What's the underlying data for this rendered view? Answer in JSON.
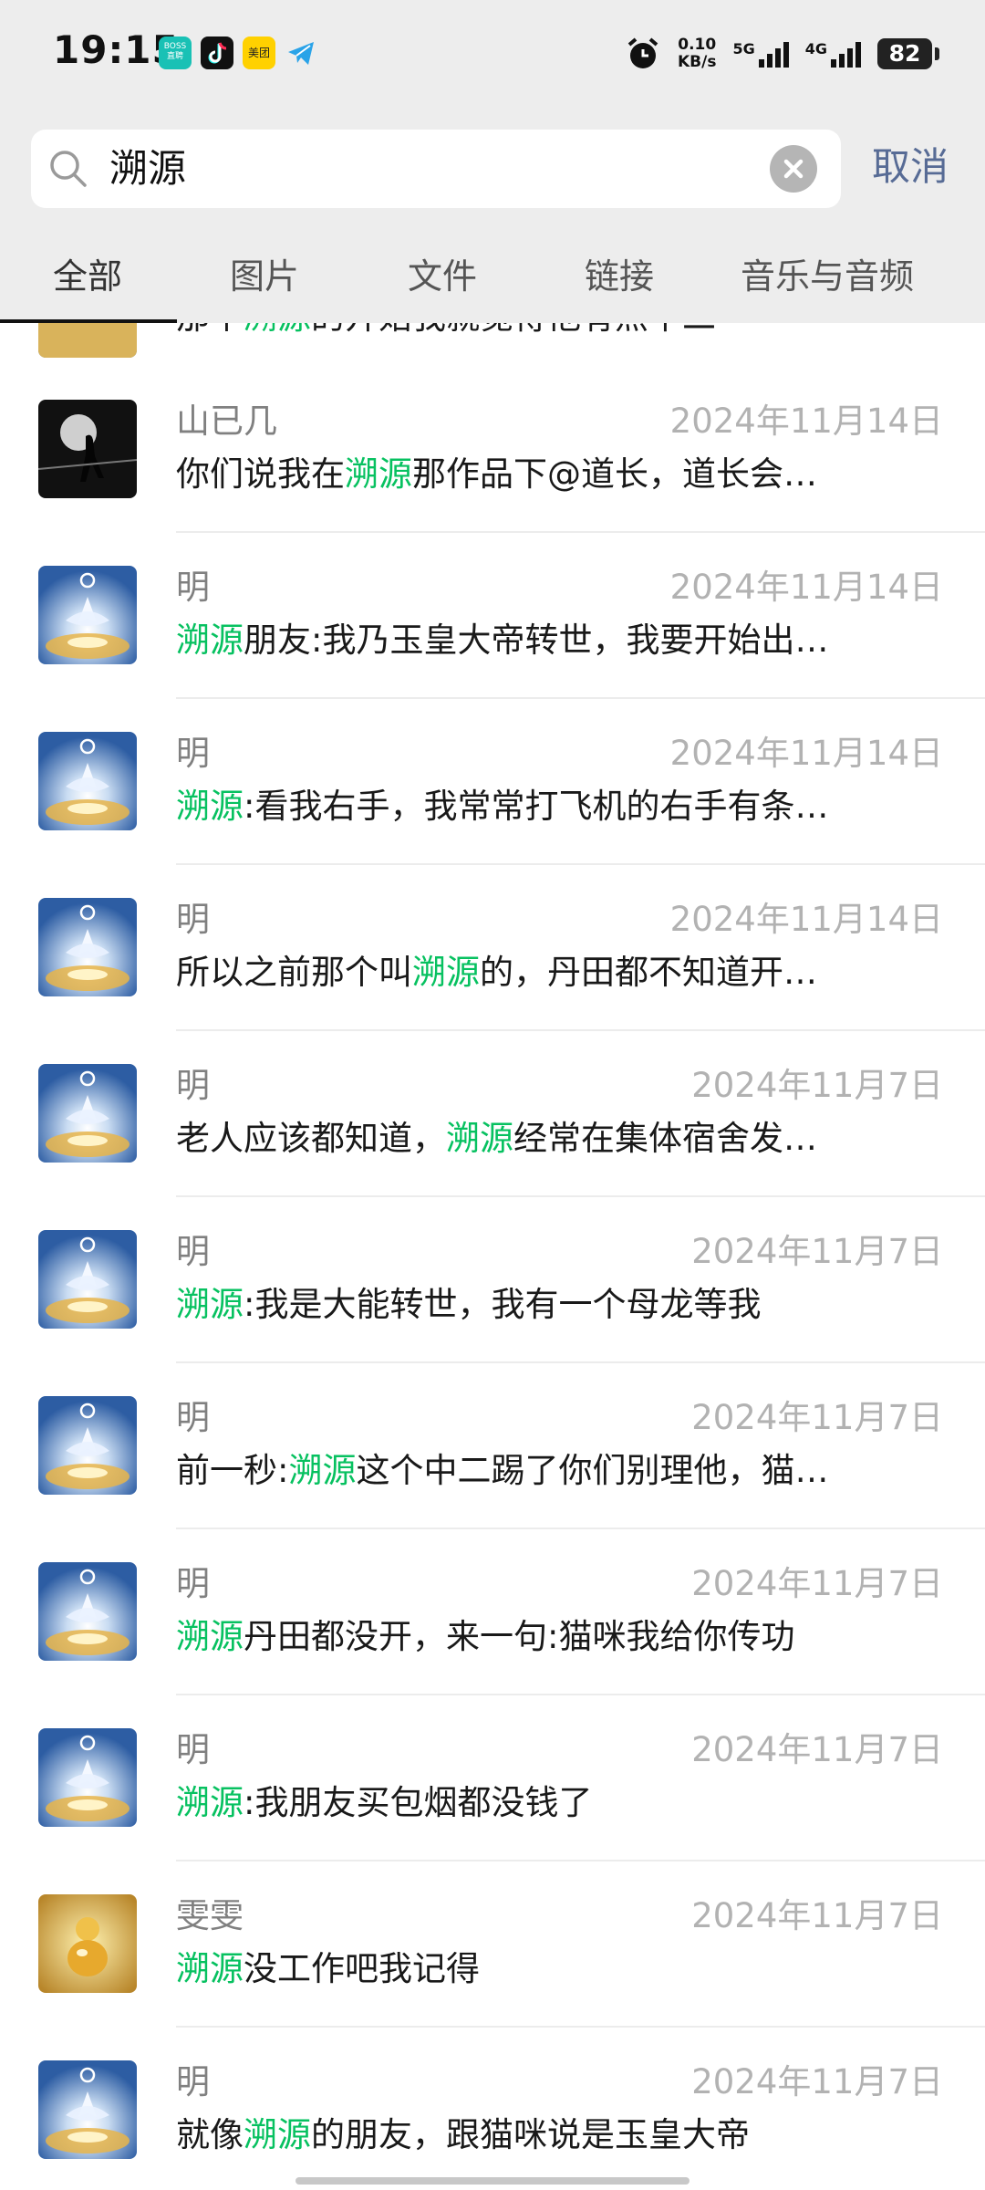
{
  "status_bar": {
    "time": "19:15",
    "net_speed_value": "0.10",
    "net_speed_unit": "KB/s",
    "signal_1_label": "5G",
    "signal_2_label": "4G",
    "battery": "82",
    "app_icons": [
      {
        "name": "boss-zhipin-icon",
        "text": "BOSS 直聘",
        "color": "#19c1b5"
      },
      {
        "name": "tiktok-icon",
        "text": "",
        "color": "#111111"
      },
      {
        "name": "meituan-icon",
        "text": "美团",
        "color": "#ffd100"
      },
      {
        "name": "telegram-icon",
        "text": "",
        "color": "#2aa3e8"
      }
    ],
    "alarm_icon": "alarm-clock-icon"
  },
  "search": {
    "query": "溯源",
    "cancel_label": "取消"
  },
  "tabs": [
    "全部",
    "图片",
    "文件",
    "链接",
    "音乐与音频"
  ],
  "active_tab": 0,
  "highlight_color": "#07c160",
  "partial_first_row": {
    "msg_before": "那个",
    "msg_hl": "溯源",
    "msg_after": "的开始我就觉得他有点中二"
  },
  "results": [
    {
      "name": "山已几",
      "date": "2024年11月14日",
      "avatar": "moon",
      "before": "你们说我在",
      "hl": "溯源",
      "after": "那作品下@道长，道长会…"
    },
    {
      "name": "明",
      "date": "2024年11月14日",
      "avatar": "lotus",
      "before": "",
      "hl": "溯源",
      "after": "朋友:我乃玉皇大帝转世，我要开始出…"
    },
    {
      "name": "明",
      "date": "2024年11月14日",
      "avatar": "lotus",
      "before": "",
      "hl": "溯源",
      "after": ":看我右手，我常常打飞机的右手有条…"
    },
    {
      "name": "明",
      "date": "2024年11月14日",
      "avatar": "lotus",
      "before": "所以之前那个叫",
      "hl": "溯源",
      "after": "的，丹田都不知道开…"
    },
    {
      "name": "明",
      "date": "2024年11月7日",
      "avatar": "lotus",
      "before": "老人应该都知道，",
      "hl": "溯源",
      "after": "经常在集体宿舍发…"
    },
    {
      "name": "明",
      "date": "2024年11月7日",
      "avatar": "lotus",
      "before": "",
      "hl": "溯源",
      "after": ":我是大能转世，我有一个母龙等我"
    },
    {
      "name": "明",
      "date": "2024年11月7日",
      "avatar": "lotus",
      "before": "前一秒:",
      "hl": "溯源",
      "after": "这个中二踢了你们别理他，猫…"
    },
    {
      "name": "明",
      "date": "2024年11月7日",
      "avatar": "lotus",
      "before": "",
      "hl": "溯源",
      "after": "丹田都没开，来一句:猫咪我给你传功"
    },
    {
      "name": "明",
      "date": "2024年11月7日",
      "avatar": "lotus",
      "before": "",
      "hl": "溯源",
      "after": ":我朋友买包烟都没钱了"
    },
    {
      "name": "雯雯",
      "date": "2024年11月7日",
      "avatar": "gold",
      "before": "",
      "hl": "溯源",
      "after": "没工作吧我记得"
    },
    {
      "name": "明",
      "date": "2024年11月7日",
      "avatar": "lotus",
      "before": "就像",
      "hl": "溯源",
      "after": "的朋友，跟猫咪说是玉皇大帝"
    }
  ]
}
